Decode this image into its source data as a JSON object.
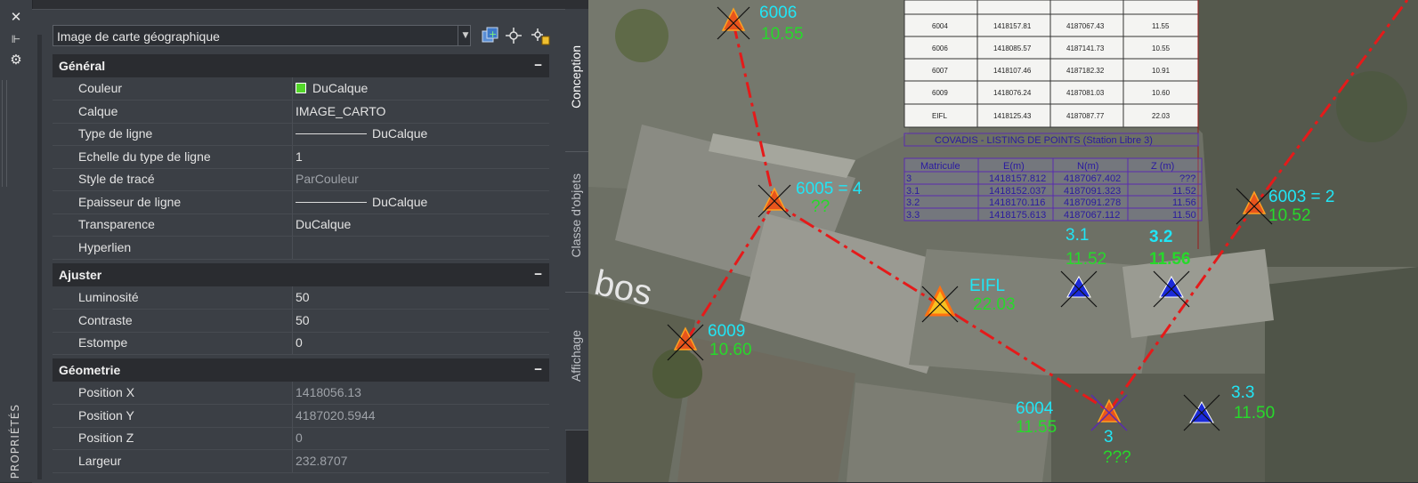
{
  "palette": {
    "title": "PROPRIÉTÉS"
  },
  "selector": {
    "value": "Image de carte géographique"
  },
  "sections": {
    "general": {
      "title": "Général",
      "collapse": "−"
    },
    "ajuster": {
      "title": "Ajuster",
      "collapse": "−"
    },
    "geometrie": {
      "title": "Géometrie",
      "collapse": "−"
    }
  },
  "rows": {
    "couleur": {
      "label": "Couleur",
      "value": "DuCalque",
      "swatch": "#53d62a"
    },
    "calque": {
      "label": "Calque",
      "value": "IMAGE_CARTO"
    },
    "type_ligne": {
      "label": "Type de ligne",
      "value": "DuCalque"
    },
    "echelle": {
      "label": "Echelle du type de ligne",
      "value": "1"
    },
    "style_trace": {
      "label": "Style de tracé",
      "value": "ParCouleur"
    },
    "epaisseur": {
      "label": "Epaisseur de ligne",
      "value": "DuCalque"
    },
    "transparence": {
      "label": "Transparence",
      "value": "DuCalque"
    },
    "hyperlien": {
      "label": "Hyperlien",
      "value": ""
    },
    "luminosite": {
      "label": "Luminosité",
      "value": "50"
    },
    "contraste": {
      "label": "Contraste",
      "value": "50"
    },
    "estompe": {
      "label": "Estompe",
      "value": "0"
    },
    "pos_x": {
      "label": "Position X",
      "value": "1418056.13"
    },
    "pos_y": {
      "label": "Position Y",
      "value": "4187020.5944"
    },
    "pos_z": {
      "label": "Position Z",
      "value": "0"
    },
    "largeur": {
      "label": "Largeur",
      "value": "232.8707"
    }
  },
  "tabs": {
    "conception": "Conception",
    "classe": "Classe d'objets",
    "affichage": "Affichage"
  },
  "map": {
    "street_text": "bos",
    "points": [
      {
        "name": "6006",
        "z": "10.55"
      },
      {
        "name": "6005 = 4",
        "z": "??"
      },
      {
        "name": "EIFL",
        "z": "22.03"
      },
      {
        "name": "6009",
        "z": "10.60"
      },
      {
        "name": "6004",
        "z": "11.55"
      },
      {
        "name": "3",
        "z": "???"
      },
      {
        "name": "6003 = 2",
        "z": "10.52"
      },
      {
        "name": "3.1",
        "z": "11.52"
      },
      {
        "name": "3.2",
        "z": "11.56"
      },
      {
        "name": "3.3",
        "z": "11.50"
      }
    ],
    "top_table": [
      [
        "6004",
        "1418157.81",
        "4187067.43",
        "11.55"
      ],
      [
        "6006",
        "1418085.57",
        "4187141.73",
        "10.55"
      ],
      [
        "6007",
        "1418107.46",
        "4187182.32",
        "10.91"
      ],
      [
        "6009",
        "1418076.24",
        "4187081.03",
        "10.60"
      ],
      [
        "EIFL",
        "1418125.43",
        "4187087.77",
        "22.03"
      ]
    ],
    "listing": {
      "title": "COVADIS - LISTING DE POINTS (Station Libre 3)",
      "headers": [
        "Matricule",
        "E(m)",
        "N(m)",
        "Z (m)"
      ],
      "rows": [
        [
          "3",
          "1418157.812",
          "4187067.402",
          "???"
        ],
        [
          "3.1",
          "1418152.037",
          "4187091.323",
          "11.52"
        ],
        [
          "3.2",
          "1418170.116",
          "4187091.278",
          "11.56"
        ],
        [
          "3.3",
          "1418175.613",
          "4187067.112",
          "11.50"
        ]
      ]
    }
  }
}
